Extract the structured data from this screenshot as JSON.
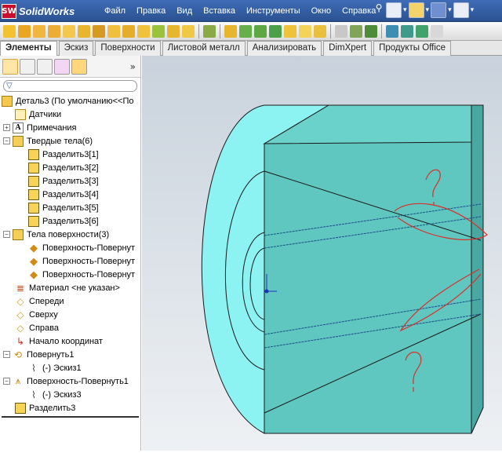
{
  "app": {
    "logo_badge": "SW",
    "logo_text": "SolidWorks"
  },
  "menu": [
    "Файл",
    "Правка",
    "Вид",
    "Вставка",
    "Инструменты",
    "Окно",
    "Справка"
  ],
  "tabs": [
    {
      "label": "Элементы",
      "active": true
    },
    {
      "label": "Эскиз",
      "active": false
    },
    {
      "label": "Поверхности",
      "active": false
    },
    {
      "label": "Листовой металл",
      "active": false
    },
    {
      "label": "Анализировать",
      "active": false
    },
    {
      "label": "DimXpert",
      "active": false
    },
    {
      "label": "Продукты Office",
      "active": false
    }
  ],
  "tree": {
    "root": "Деталь3  (По умолчанию<<По",
    "sensors": "Датчики",
    "annotations": "Примечания",
    "solid_bodies": "Твердые тела(6)",
    "splits": [
      "Разделить3[1]",
      "Разделить3[2]",
      "Разделить3[3]",
      "Разделить3[4]",
      "Разделить3[5]",
      "Разделить3[6]"
    ],
    "surface_bodies": "Тела поверхности(3)",
    "surfaces": [
      "Поверхность-Повернут",
      "Поверхность-Повернут",
      "Поверхность-Повернут"
    ],
    "material": "Материал <не указан>",
    "front": "Спереди",
    "top": "Сверху",
    "right": "Справа",
    "origin": "Начало координат",
    "revolve1": "Повернуть1",
    "sketch1": "(-) Эскиз1",
    "surface_revolve1": "Поверхность-Повернуть1",
    "sketch3": "(-) Эскиз3",
    "split3": "Разделить3"
  },
  "colors": {
    "body_fill": "#8cf2f2",
    "body_side": "#5fc6c0",
    "annotation": "#d9302a",
    "menubar": "#3f6db7"
  }
}
